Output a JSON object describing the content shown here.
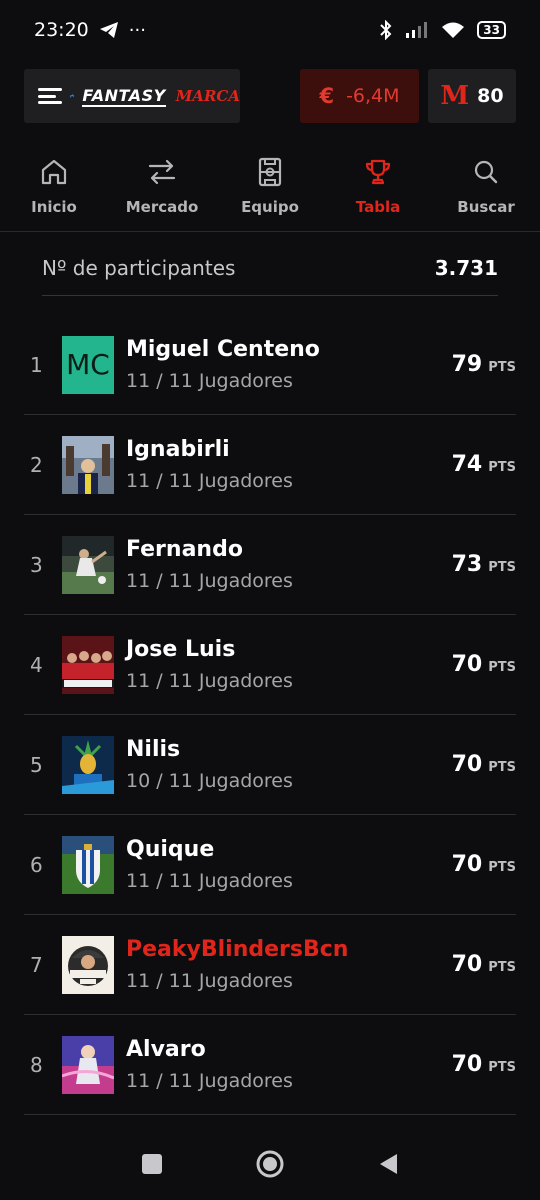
{
  "status": {
    "time": "23:20",
    "battery": "33"
  },
  "header": {
    "brand_fantasy": "FANTASY",
    "brand_marca": "MARCA",
    "budget_symbol": "€",
    "budget": "-6,4M",
    "points_logo": "M",
    "points": "80"
  },
  "nav": [
    {
      "label": "Inicio",
      "icon": "home-icon"
    },
    {
      "label": "Mercado",
      "icon": "transfer-arrows-icon"
    },
    {
      "label": "Equipo",
      "icon": "pitch-icon"
    },
    {
      "label": "Tabla",
      "icon": "trophy-icon"
    },
    {
      "label": "Buscar",
      "icon": "search-icon"
    }
  ],
  "participants": {
    "label": "Nº de participantes",
    "count": "3.731"
  },
  "standings": [
    {
      "rank": "1",
      "name": "Miguel Centeno",
      "initials": "MC",
      "players": "11 / 11 Jugadores",
      "points": "79",
      "unit": "PTS"
    },
    {
      "rank": "2",
      "name": "Ignabirli",
      "players": "11 / 11 Jugadores",
      "points": "74",
      "unit": "PTS"
    },
    {
      "rank": "3",
      "name": "Fernando",
      "players": "11 / 11 Jugadores",
      "points": "73",
      "unit": "PTS"
    },
    {
      "rank": "4",
      "name": "Jose Luis",
      "players": "11 / 11 Jugadores",
      "points": "70",
      "unit": "PTS"
    },
    {
      "rank": "5",
      "name": "Nilis",
      "players": "10 / 11 Jugadores",
      "points": "70",
      "unit": "PTS"
    },
    {
      "rank": "6",
      "name": "Quique",
      "players": "11 / 11 Jugadores",
      "points": "70",
      "unit": "PTS"
    },
    {
      "rank": "7",
      "name": "PeakyBlindersBcn",
      "players": "11 / 11 Jugadores",
      "points": "70",
      "unit": "PTS"
    },
    {
      "rank": "8",
      "name": "Alvaro",
      "players": "11 / 11 Jugadores",
      "points": "70",
      "unit": "PTS"
    }
  ],
  "colors": {
    "accent": "#e0251b",
    "background": "#0d0d0f",
    "initials_bg": "#22b58e"
  }
}
